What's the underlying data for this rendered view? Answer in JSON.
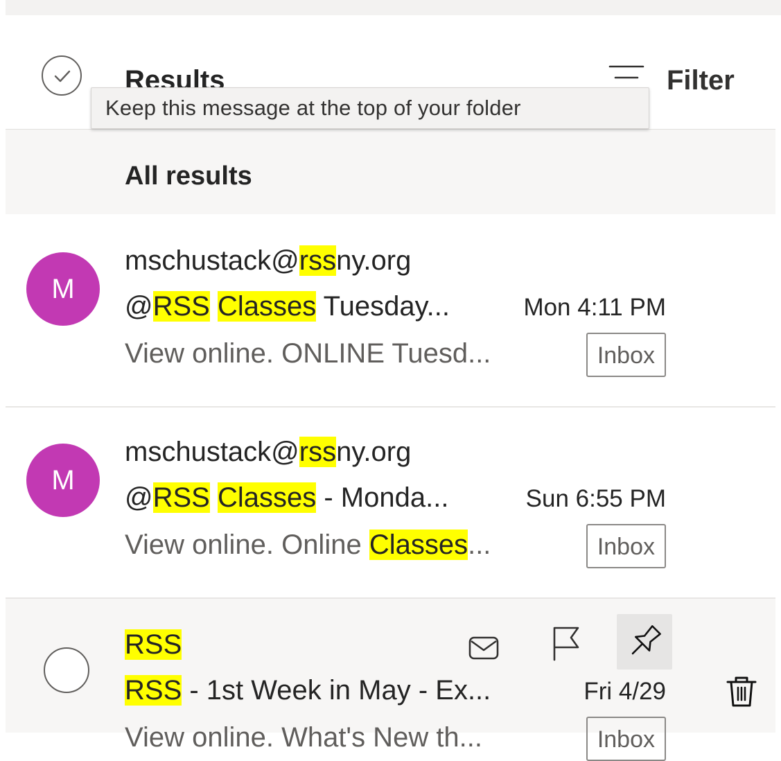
{
  "header": {
    "title": "Results",
    "filter_label": "Filter"
  },
  "tooltip": {
    "text": "Keep this message at the top of your folder"
  },
  "group": {
    "label": "All results"
  },
  "messages": [
    {
      "avatar_initial": "M",
      "avatar_color": "#c239b3",
      "sender": {
        "before": "mschustack@",
        "hl": "rss",
        "after": "ny.org"
      },
      "subject": {
        "prefix": "@",
        "hl1": "RSS",
        "hl2": "Classes",
        "rest": " Tuesday..."
      },
      "date": "Mon 4:11 PM",
      "preview": "View online. ONLINE Tuesd...",
      "folder": "Inbox"
    },
    {
      "avatar_initial": "M",
      "avatar_color": "#c239b3",
      "sender": {
        "before": "mschustack@",
        "hl": "rss",
        "after": "ny.org"
      },
      "subject": {
        "prefix": "@",
        "hl1": "RSS",
        "hl2": "Classes",
        "rest": " - Monda..."
      },
      "date": "Sun 6:55 PM",
      "preview": {
        "before": "View online. Online ",
        "hl": "Classes",
        "after": "..."
      },
      "folder": "Inbox"
    },
    {
      "sender": {
        "hl": "RSS"
      },
      "subject": {
        "hl": "RSS",
        "rest": " - 1st Week in May - Ex..."
      },
      "date": "Fri 4/29",
      "preview": "View online. What's New th...",
      "folder": "Inbox",
      "actions": [
        "envelope-icon",
        "flag-icon",
        "pin-icon",
        "trash-icon"
      ]
    }
  ],
  "colors": {
    "highlight": "#ffff00",
    "avatar": "#c239b3",
    "hover_row": "#f7f6f5",
    "tooltip_bg": "#f3f2f1"
  }
}
